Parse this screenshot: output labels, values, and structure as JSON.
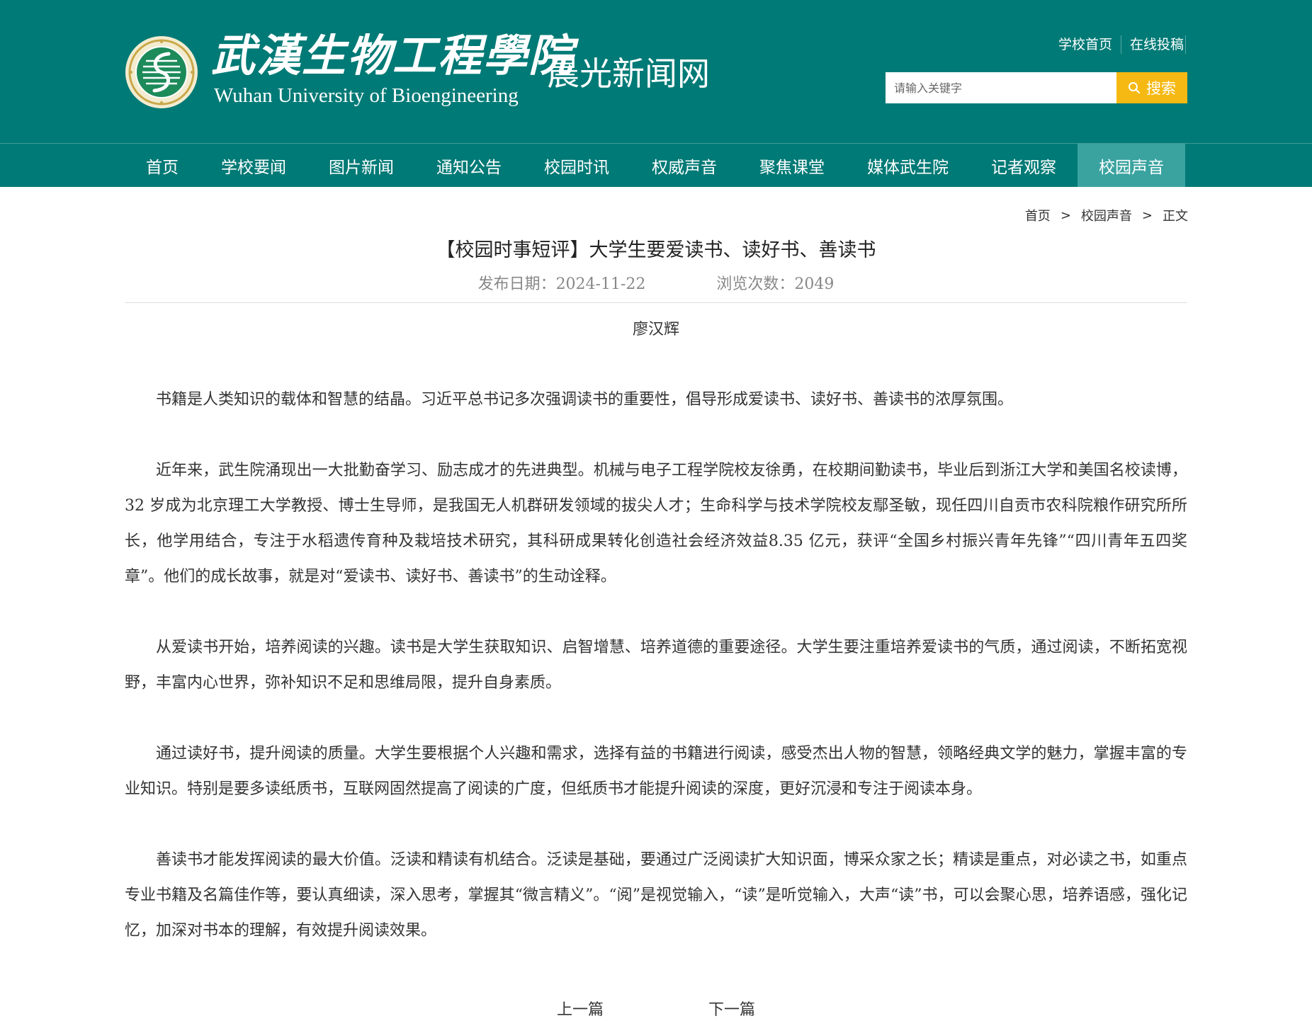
{
  "header": {
    "logo_cn": "武漢生物工程學院",
    "logo_en": "Wuhan University of Bioengineering",
    "site_name": "晨光新闻网",
    "top_links": [
      "学校首页",
      "在线投稿"
    ],
    "search": {
      "placeholder": "请输入关键字",
      "button_label": "搜索"
    }
  },
  "nav": {
    "items": [
      "首页",
      "学校要闻",
      "图片新闻",
      "通知公告",
      "校园时讯",
      "权威声音",
      "聚焦课堂",
      "媒体武生院",
      "记者观察",
      "校园声音"
    ],
    "active": "校园声音"
  },
  "breadcrumb": {
    "items": [
      "首页",
      "校园声音",
      "正文"
    ],
    "separator": ">"
  },
  "article": {
    "title": "【校园时事短评】大学生要爱读书、读好书、善读书",
    "publish_date": "发布日期：2024-11-22",
    "views": "浏览次数：2049",
    "author": "廖汉辉",
    "paragraphs": [
      "书籍是人类知识的载体和智慧的结晶。习近平总书记多次强调读书的重要性，倡导形成爱读书、读好书、善读书的浓厚氛围。",
      "近年来，武生院涌现出一大批勤奋学习、励志成才的先进典型。机械与电子工程学院校友徐勇，在校期间勤读书，毕业后到浙江大学和美国名校读博，32 岁成为北京理工大学教授、博士生导师，是我国无人机群研发领域的拔尖人才；生命科学与技术学院校友鄢圣敏，现任四川自贡市农科院粮作研究所所长，他学用结合，专注于水稻遗传育种及栽培技术研究，其科研成果转化创造社会经济效益8.35 亿元，获评“全国乡村振兴青年先锋”“四川青年五四奖章”。他们的成长故事，就是对“爱读书、读好书、善读书”的生动诠释。",
      "从爱读书开始，培养阅读的兴趣。读书是大学生获取知识、启智增慧、培养道德的重要途径。大学生要注重培养爱读书的气质，通过阅读，不断拓宽视野，丰富内心世界，弥补知识不足和思维局限，提升自身素质。",
      "通过读好书，提升阅读的质量。大学生要根据个人兴趣和需求，选择有益的书籍进行阅读，感受杰出人物的智慧，领略经典文学的魅力，掌握丰富的专业知识。特别是要多读纸质书，互联网固然提高了阅读的广度，但纸质书才能提升阅读的深度，更好沉浸和专注于阅读本身。",
      "善读书才能发挥阅读的最大价值。泛读和精读有机结合。泛读是基础，要通过广泛阅读扩大知识面，博采众家之长；精读是重点，对必读之书，如重点专业书籍及名篇佳作等，要认真细读，深入思考，掌握其“微言精义”。“阅”是视觉输入，“读”是听觉输入，大声“读”书，可以会聚心思，培养语感，强化记忆，加深对书本的理解，有效提升阅读效果。"
    ]
  },
  "pager": {
    "prev": "上一篇",
    "next": "下一篇"
  },
  "colors": {
    "brand": "#007a76",
    "nav_active": "#3aa3a0",
    "search_button": "#f6b913"
  },
  "icons": {
    "logo": "university-emblem-icon",
    "search": "search-icon"
  }
}
